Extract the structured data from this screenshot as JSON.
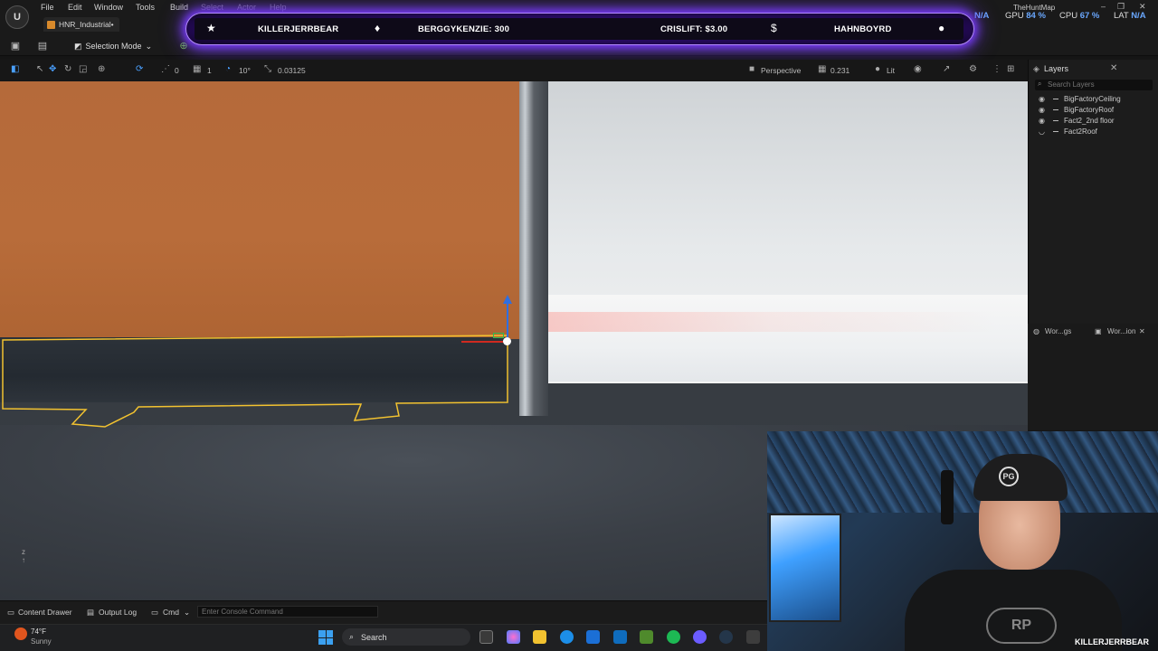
{
  "app": {
    "logo": "U",
    "menu": [
      "File",
      "Edit",
      "Window",
      "Tools",
      "Build",
      "Select",
      "Actor",
      "Help"
    ],
    "project_tab": "HNR_Industrial•",
    "map_name": "TheHuntMap"
  },
  "stats": {
    "na_left": "N/A",
    "gpu_label": "GPU",
    "gpu_value": "84 %",
    "cpu_label": "CPU",
    "cpu_value": "67 %",
    "lat_label": "LAT",
    "lat_value": "N/A"
  },
  "overlay": {
    "item1": "KILLERJERRBEAR",
    "item2": "BERGGYKENZIE: 300",
    "item3": "CRISLIFT: $3.00",
    "item4": "HAHNBOYRD",
    "icons": [
      "star-icon",
      "drop-icon",
      "dollar-icon",
      "user-icon"
    ]
  },
  "toolbar": {
    "selection_mode": "Selection Mode"
  },
  "viewport_toolbar": {
    "rotation_snap": "10°",
    "grid_snap": "1",
    "scale_snap": "0.03125",
    "angle_snap": "0",
    "view_mode": "Perspective",
    "camera_speed": "0.231",
    "lighting": "Lit"
  },
  "layers": {
    "title": "Layers",
    "search_placeholder": "Search Layers",
    "items": [
      "BigFactoryCeiling",
      "BigFactoryRoof",
      "Fact2_2nd floor",
      "Fact2Roof"
    ]
  },
  "bottom_tabs": [
    "Wor...gs",
    "Wor...ion"
  ],
  "bottombar": {
    "content_drawer": "Content Drawer",
    "output_log": "Output Log",
    "cmd": "Cmd",
    "console_placeholder": "Enter Console Command"
  },
  "taskbar": {
    "temperature": "74°F",
    "weather": "Sunny",
    "search": "Search"
  },
  "webcam": {
    "name": "KILLERJERRBEAR",
    "cap_logo": "PG",
    "shirt_logo": "RP"
  },
  "colors": {
    "overlay_glow": "#7a3cff",
    "selection_outline": "#f2c230",
    "wall": "#b86c3a"
  }
}
